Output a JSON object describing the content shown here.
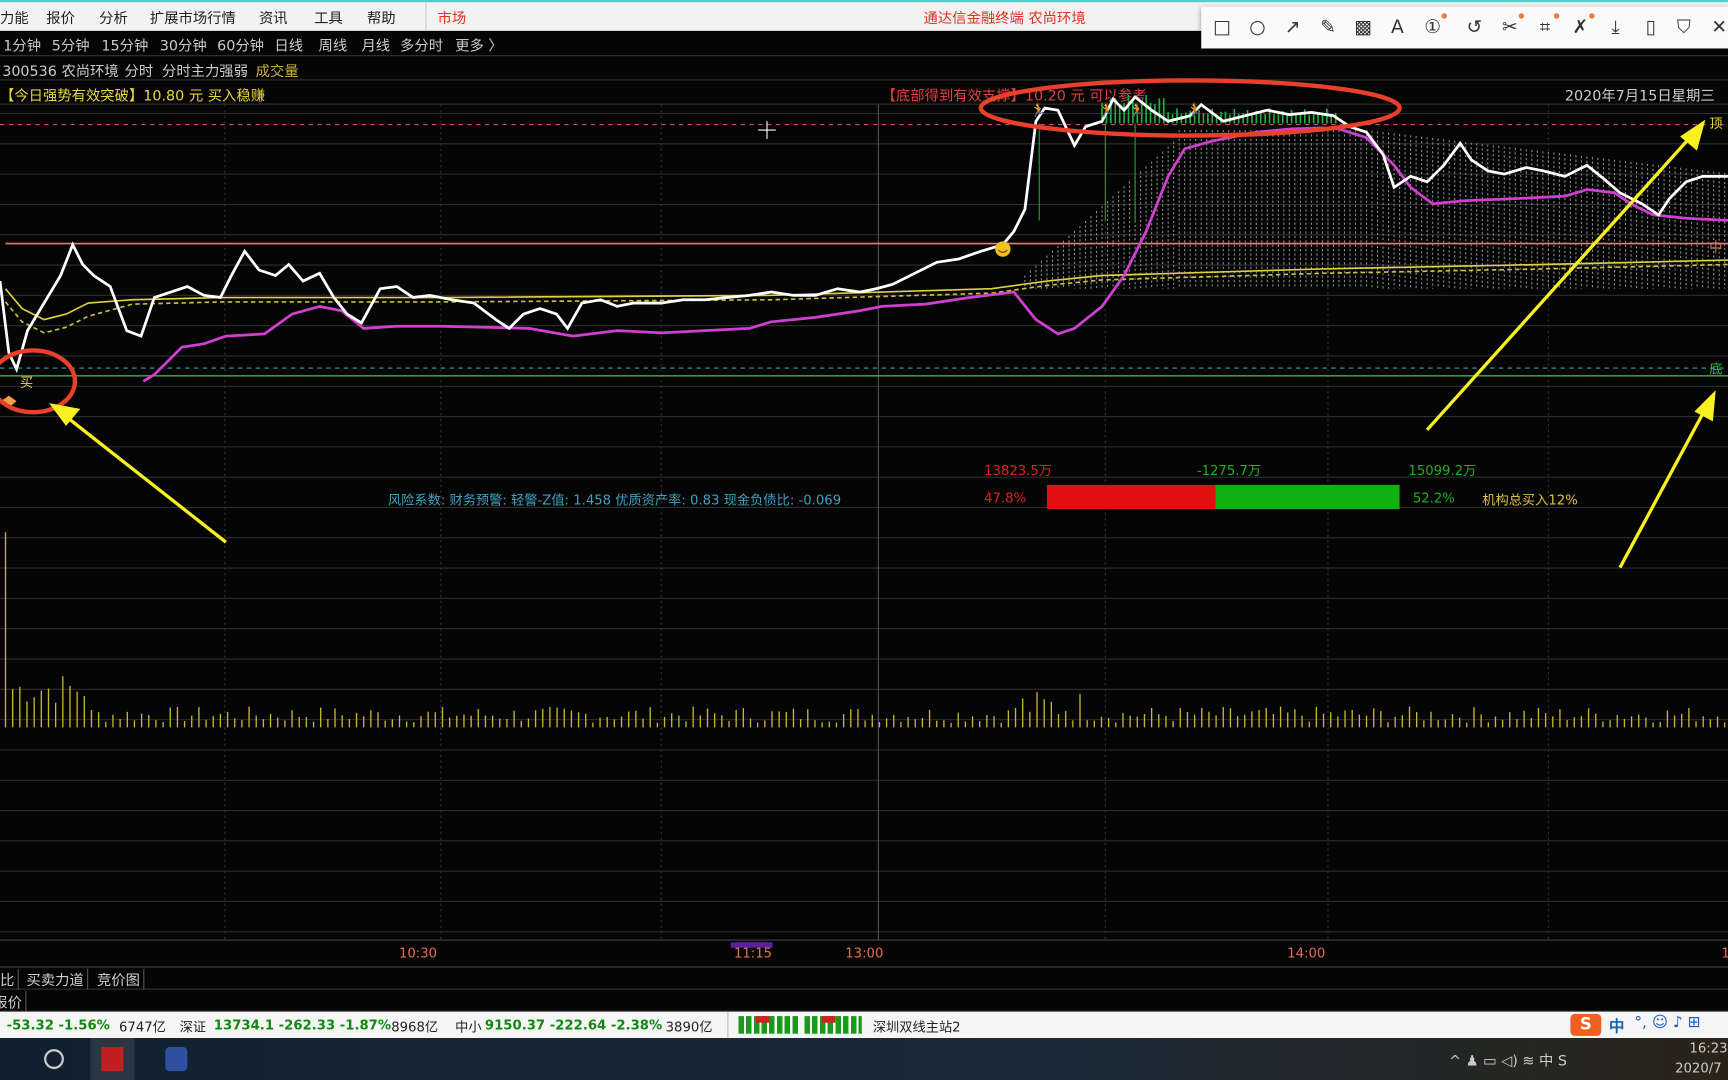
{
  "menu": {
    "items": [
      "力能",
      "报价",
      "分析",
      "扩展市场行情",
      "资讯",
      "工具",
      "帮助"
    ],
    "market": "市场",
    "window_title": "通达信金融终端  农尚环境"
  },
  "annotation_toolbar": {
    "icons": [
      "rectangle-icon",
      "circle-icon",
      "arrow-icon",
      "pencil-icon",
      "mosaic-icon",
      "text-icon",
      "number-icon",
      "undo-icon",
      "cut-icon",
      "screenshot-icon",
      "pin-icon",
      "download-icon",
      "phone-icon",
      "bookmark-icon",
      "close-icon"
    ],
    "glyphs": [
      "□",
      "○",
      "↗",
      "✎",
      "▩",
      "A",
      "①",
      "↺",
      "✂",
      "⌗",
      "✗",
      "⤓",
      "▯",
      "⛉",
      "✕"
    ]
  },
  "periods": [
    "1分钟",
    "5分钟",
    "15分钟",
    "30分钟",
    "60分钟",
    "日线",
    "周线",
    "月线",
    "多分时",
    "更多 〉"
  ],
  "stock_header": {
    "code_name": "300536 农尚环境",
    "view": "分时",
    "indicator": "分时主力强弱",
    "volume": "成交量"
  },
  "signals": {
    "buy_signal": "【今日强势有效突破】10.80 元 买入稳赚",
    "support_signal": "【底部得到有效支撑】10.20 元 可以参考",
    "date": "2020年7月15日星期三"
  },
  "chart_labels": {
    "top": "顶",
    "mid": "中",
    "bottom": "底",
    "buy": "买"
  },
  "fund_flow": {
    "sell_amount": "13823.5万",
    "net_amount": "-1275.7万",
    "buy_amount": "15099.2万",
    "sell_pct": "47.8%",
    "buy_pct": "52.2%",
    "sell_fraction": 0.478,
    "institution": "机构总买入12%",
    "risk_text": "风险系数: 财务预警: 轻警-Z值: 1.458 优质资产率: 0.83 现金负债比: -0.069"
  },
  "time_axis": [
    "10:30",
    "11:15",
    "13:00",
    "14:00",
    "1"
  ],
  "bottom_tabs": [
    "比",
    "买卖力道",
    "竞价图"
  ],
  "quote_tab": "报价",
  "status": {
    "sh": "-53.32  -1.56%",
    "sh_vol": "6747亿",
    "sz_label": "深证",
    "sz": "13734.1  -262.33  -1.87%",
    "sz_vol": "8968亿",
    "zx_label": "中小",
    "zx": "9150.37  -222.64  -2.38%",
    "zx_vol": "3890亿",
    "server": "深圳双线主站2",
    "ime": "中"
  },
  "taskbar": {
    "time": "16:23",
    "date": "2020/7"
  },
  "colors": {
    "price": "#ffffff",
    "main_force": "#d040d0",
    "average": "#e0d040",
    "annotation_red": "#e8402a",
    "arrow_yellow": "#f8f020",
    "up_red": "#e01010",
    "down_green": "#10b010"
  }
}
